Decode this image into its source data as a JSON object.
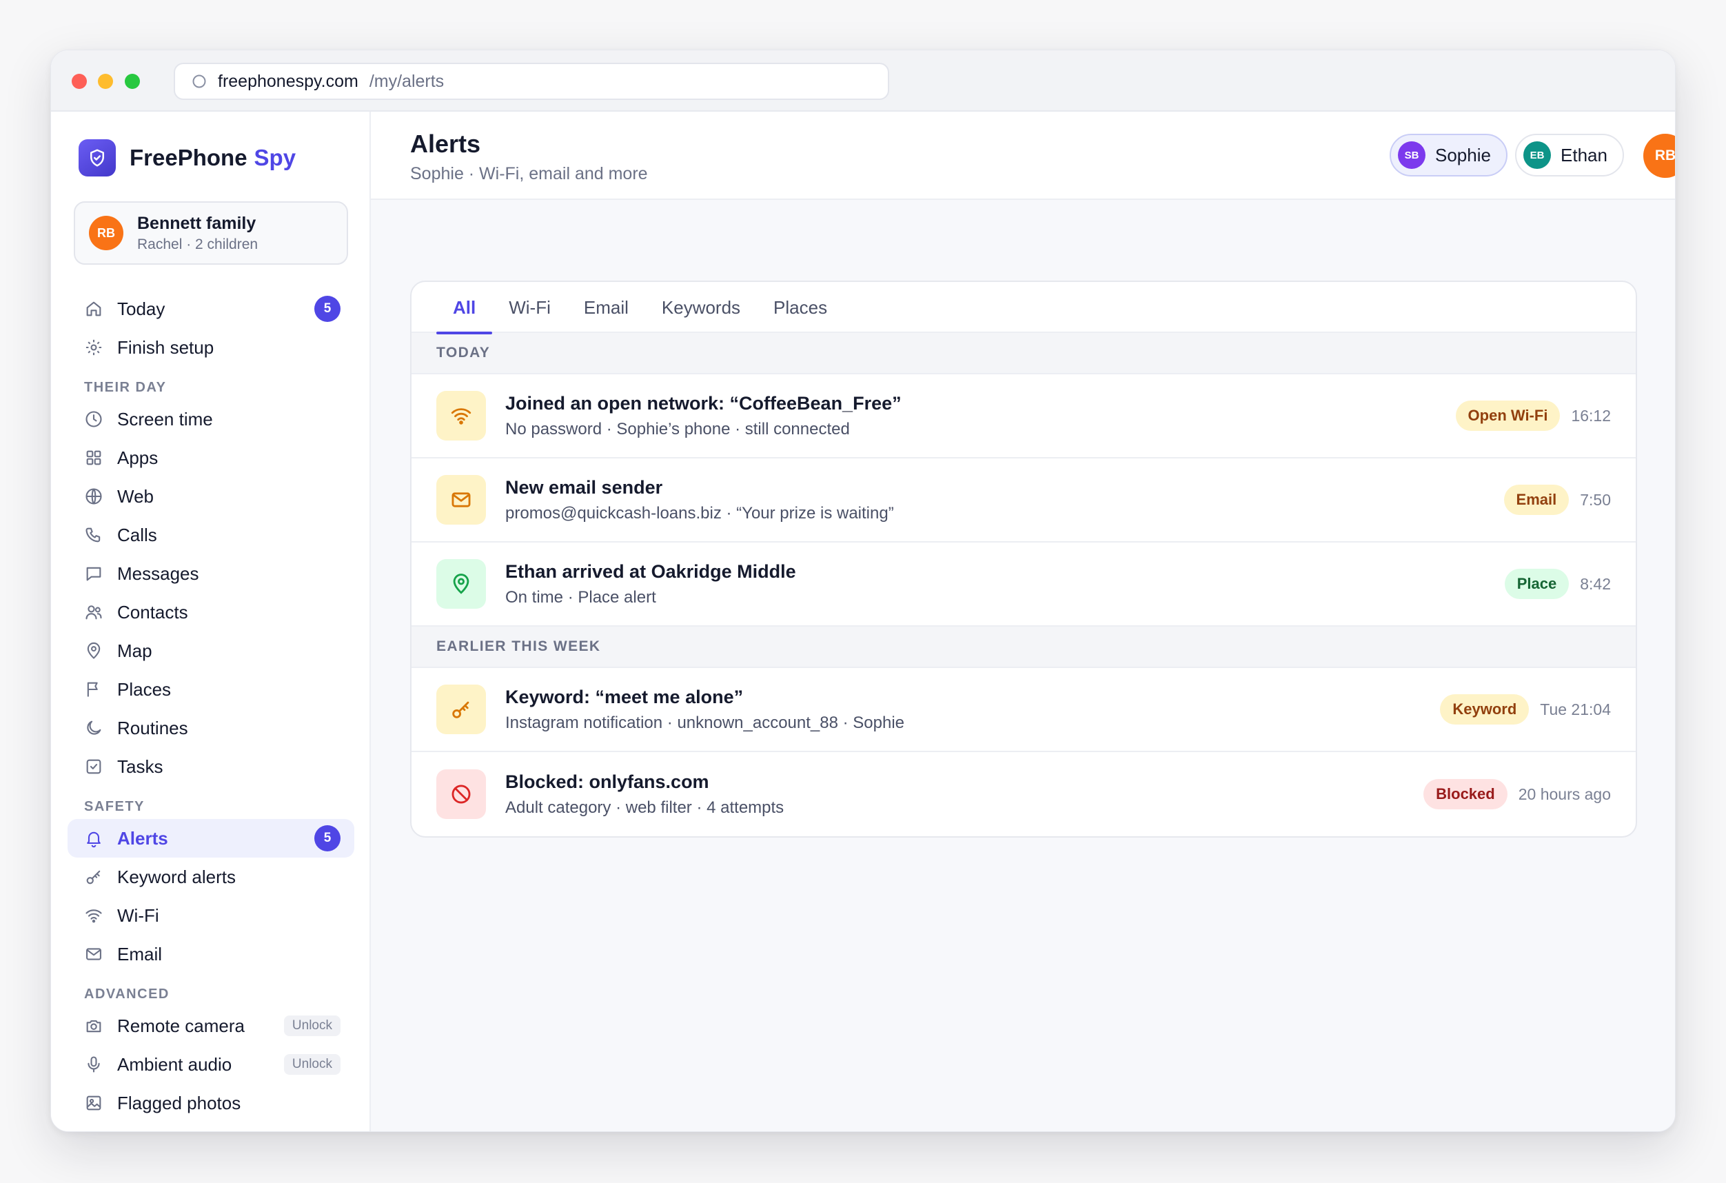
{
  "browser": {
    "domain": "freephonespy.com",
    "path": "/my/alerts"
  },
  "brand": {
    "name": "FreePhone",
    "accent": "Spy"
  },
  "family": {
    "initials": "RB",
    "name": "Bennett family",
    "sub": "Rachel · 2 children"
  },
  "nav": {
    "today": {
      "label": "Today",
      "badge": "5"
    },
    "finish_setup": {
      "label": "Finish setup"
    },
    "section_their_day": "THEIR DAY",
    "screen_time": "Screen time",
    "apps": "Apps",
    "web": "Web",
    "calls": "Calls",
    "messages": "Messages",
    "contacts": "Contacts",
    "map": "Map",
    "places": "Places",
    "routines": "Routines",
    "tasks": "Tasks",
    "section_safety": "SAFETY",
    "alerts": {
      "label": "Alerts",
      "badge": "5"
    },
    "keyword_alerts": "Keyword alerts",
    "wifi": "Wi-Fi",
    "email": "Email",
    "section_advanced": "ADVANCED",
    "remote_camera": {
      "label": "Remote camera",
      "unlock": "Unlock"
    },
    "ambient_audio": {
      "label": "Ambient audio",
      "unlock": "Unlock"
    },
    "flagged_photos": "Flagged photos"
  },
  "header": {
    "title": "Alerts",
    "subtitle": "Sophie · Wi-Fi, email and more",
    "kids": [
      {
        "initials": "SB",
        "name": "Sophie",
        "selected": true
      },
      {
        "initials": "EB",
        "name": "Ethan",
        "selected": false
      }
    ],
    "user_initials": "RB"
  },
  "tabs": [
    "All",
    "Wi-Fi",
    "Email",
    "Keywords",
    "Places"
  ],
  "groups": {
    "today": {
      "label": "TODAY",
      "items": [
        {
          "icon": "wifi-icon",
          "title": "Joined an open network: “CoffeeBean_Free”",
          "sub": "No password · Sophie’s phone · still connected",
          "tag": "Open Wi-Fi",
          "time": "16:12"
        },
        {
          "icon": "mail-icon",
          "title": "New email sender",
          "sub": "promos@quickcash-loans.biz · “Your prize is waiting”",
          "tag": "Email",
          "time": "7:50"
        },
        {
          "icon": "map-pin-icon",
          "title": "Ethan arrived at Oakridge Middle",
          "sub": "On time · Place alert",
          "tag": "Place",
          "time": "8:42"
        }
      ]
    },
    "earlier": {
      "label": "EARLIER THIS WEEK",
      "items": [
        {
          "icon": "key-icon",
          "title": "Keyword: “meet me alone”",
          "sub": "Instagram notification · unknown_account_88 · Sophie",
          "tag": "Keyword",
          "time": "Tue 21:04"
        },
        {
          "icon": "blocked-icon",
          "title": "Blocked: onlyfans.com",
          "sub": "Adult category · web filter · 4 attempts",
          "tag": "Blocked",
          "time": "20 hours ago"
        }
      ]
    }
  },
  "colors": {
    "accent": "#4f46e5",
    "amber": "#d97706",
    "green": "#16a34a",
    "red": "#dc2626",
    "avatar_orange": "#f97316"
  }
}
